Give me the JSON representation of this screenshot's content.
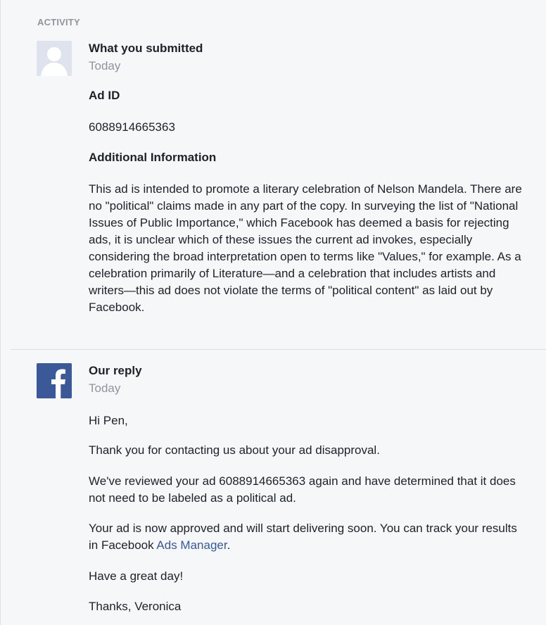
{
  "activity": {
    "heading": "ACTIVITY",
    "submission": {
      "author": "What you submitted",
      "time": "Today",
      "avatar_icon": "user-silhouette-icon",
      "ad_id_label": "Ad ID",
      "ad_id_value": "6088914665363",
      "additional_info_label": "Additional Information",
      "additional_info_text": "This ad is intended to promote a literary celebration of Nelson Mandela. There are no \"political\" claims made in any part of the copy. In surveying the list of \"National Issues of Public Importance,\" which Facebook has deemed a basis for rejecting ads, it is unclear which of these issues the current ad invokes, especially considering the broad interpretation open to terms like \"Values,\" for example. As a celebration primarily of Literature—and a celebration that includes artists and writers—this ad does not violate the terms of \"political content\" as laid out by Facebook."
    },
    "reply": {
      "author": "Our reply",
      "time": "Today",
      "avatar_icon": "facebook-logo-icon",
      "greeting": "Hi Pen,",
      "paragraph_1": "Thank you for contacting us about your ad disapproval.",
      "paragraph_2": "We've reviewed your ad 6088914665363 again and have determined that it does not need to be labeled as a political ad.",
      "paragraph_3_prefix": "Your ad is now approved and will start delivering soon. You can track your results in Facebook ",
      "paragraph_3_link": "Ads Manager",
      "paragraph_3_suffix": ".",
      "closing_1": "Have a great day!",
      "closing_2": "Thanks, Veronica"
    }
  },
  "colors": {
    "panel_bg": "#f6f7f9",
    "facebook_blue": "#3b5998",
    "link": "#385898",
    "muted_text": "#90949c",
    "body_text": "#1d2129"
  }
}
